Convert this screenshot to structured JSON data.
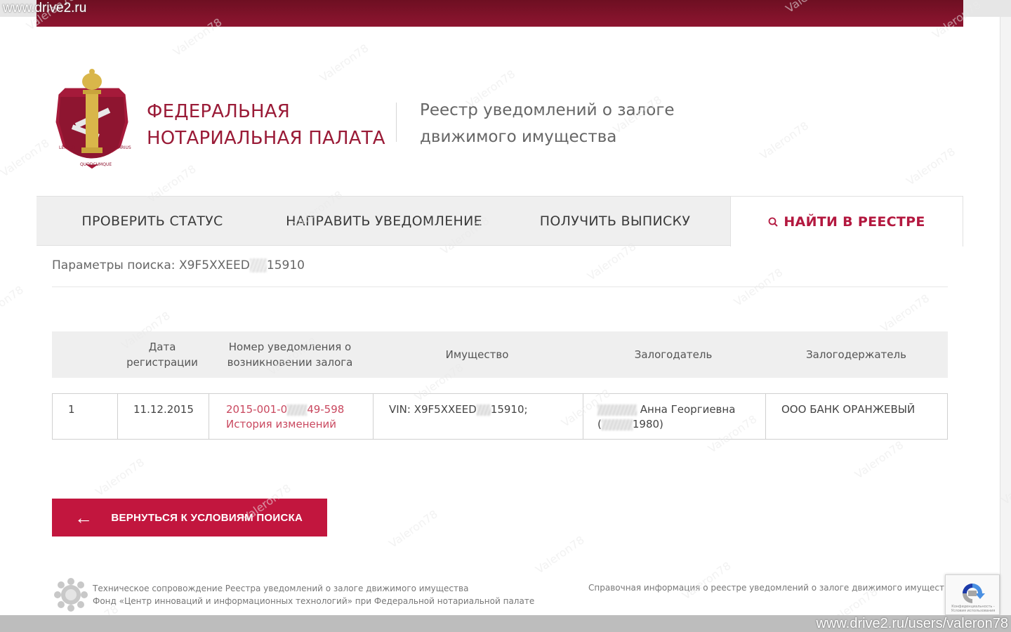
{
  "watermarks": {
    "top_left": "www.drive2.ru",
    "bottom_right": "www.drive2.ru/users/valeron78"
  },
  "header": {
    "org_name_line1": "ФЕДЕРАЛЬНАЯ",
    "org_name_line2": "НОТАРИАЛЬНАЯ ПАЛАТА",
    "registry_title_line1": "Реестр уведомлений о залоге",
    "registry_title_line2": "движимого имущества",
    "emblem_text_1": "LEX EST",
    "emblem_text_2": "NOTARIUS",
    "emblem_text_3": "QUODCUMQUE"
  },
  "tabs": [
    {
      "label": "ПРОВЕРИТЬ СТАТУС"
    },
    {
      "label": "НАПРАВИТЬ УВЕДОМЛЕНИЕ"
    },
    {
      "label": "ПОЛУЧИТЬ ВЫПИСКУ"
    },
    {
      "label": "НАЙТИ В РЕЕСТРЕ",
      "active": true
    }
  ],
  "search": {
    "params_label": "Параметры поиска:",
    "vin_start": "X9F5XXEED",
    "vin_end": "15910"
  },
  "table": {
    "headers": {
      "num": "",
      "date_line1": "Дата",
      "date_line2": "регистрации",
      "notice_line1": "Номер уведомления о",
      "notice_line2": "возникновении залога",
      "property": "Имущество",
      "pledgor": "Залогодатель",
      "pledgee": "Залогодержатель"
    },
    "rows": [
      {
        "num": "1",
        "date": "11.12.2015",
        "notice_start": "2015-001-0",
        "notice_end": "49-598",
        "history_link": "История изменений",
        "property_start": "VIN: X9F5XXEED",
        "property_end": "15910;",
        "pledgor_name": "Анна Георгиевна",
        "pledgor_year": "1980)",
        "pledgor_paren": "(",
        "pledgee": "ООО БАНК ОРАНЖЕВЫЙ"
      }
    ]
  },
  "back_button": {
    "label": "ВЕРНУТЬСЯ К УСЛОВИЯМ ПОИСКА",
    "icon": "←"
  },
  "footer": {
    "left_line1": "Техническое сопровождение Реестра уведомлений о залоге движимого имущества",
    "left_line2": "Фонд «Центр инноваций и информационных технологий» при Федеральной нотариальной палате",
    "right_link": "Справочная информация о реестре уведомлений о залоге движимого имущества",
    "recaptcha_text": "Конфиденциальность - Условия использования"
  },
  "colors": {
    "brand": "#9a1b37",
    "accent": "#c2163e",
    "link": "#c9485f",
    "tab_bg": "#efefef"
  },
  "icons": {
    "search": "search-icon",
    "back": "arrow-left-icon",
    "recaptcha": "recaptcha-icon",
    "emblem": "notary-emblem-icon",
    "footer_logo": "fund-logo-icon"
  }
}
